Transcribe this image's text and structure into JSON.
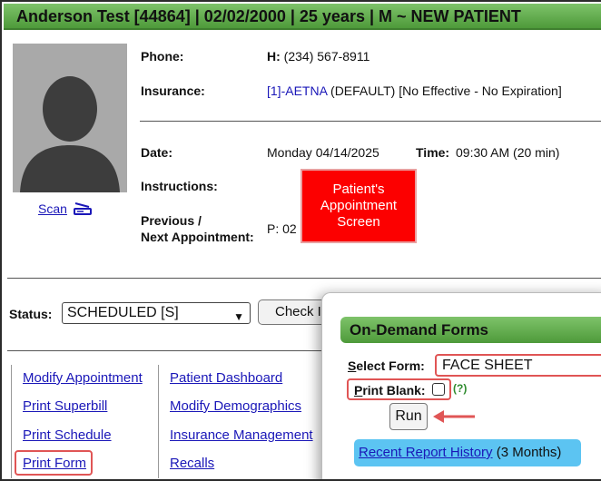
{
  "header": {
    "title": "Anderson Test [44864] | 02/02/2000 | 25 years | M  ~  NEW PATIENT"
  },
  "scan": {
    "label": "Scan",
    "icon": "scanner-icon"
  },
  "details": {
    "phone_label": "Phone:",
    "phone_prefix": "H:",
    "phone_value": "(234) 567-8911",
    "insurance_label": "Insurance:",
    "insurance_link": "[1]-AETNA",
    "insurance_rest": "(DEFAULT) [No Effective - No Expiration]",
    "date_label": "Date:",
    "date_value": "Monday 04/14/2025",
    "time_label": "Time:",
    "time_value": "09:30 AM (20 min)",
    "instructions_label": "Instructions:",
    "prev_label_1": "Previous /",
    "prev_label_2": "Next Appointment:",
    "prev_value": "P: 02"
  },
  "callout": {
    "text": "Patient's Appointment Screen",
    "color": "#fc0000"
  },
  "status": {
    "label": "Status:",
    "selected": "SCHEDULED [S]",
    "check_in_label": "Check I"
  },
  "links": {
    "col1": [
      "Modify Appointment",
      "Print Superbill",
      "Print Schedule",
      "Print Form"
    ],
    "col2": [
      "Patient Dashboard",
      "Modify Demographics",
      "Insurance Management",
      "Recalls"
    ]
  },
  "on_demand": {
    "title": "On-Demand Forms",
    "select_label_first": "S",
    "select_label_rest": "elect Form:",
    "form_value": "FACE SHEET",
    "print_blank_first": "P",
    "print_blank_rest": "rint Blank:",
    "help": "(?)",
    "run_label": "Run",
    "history_link": "Recent Report History",
    "history_suffix": "(3 Months)"
  },
  "colors": {
    "header_green": "#5ba845",
    "link_blue": "#1a17b8",
    "highlight_red": "#e05555",
    "history_bg": "#5cc4f2"
  }
}
